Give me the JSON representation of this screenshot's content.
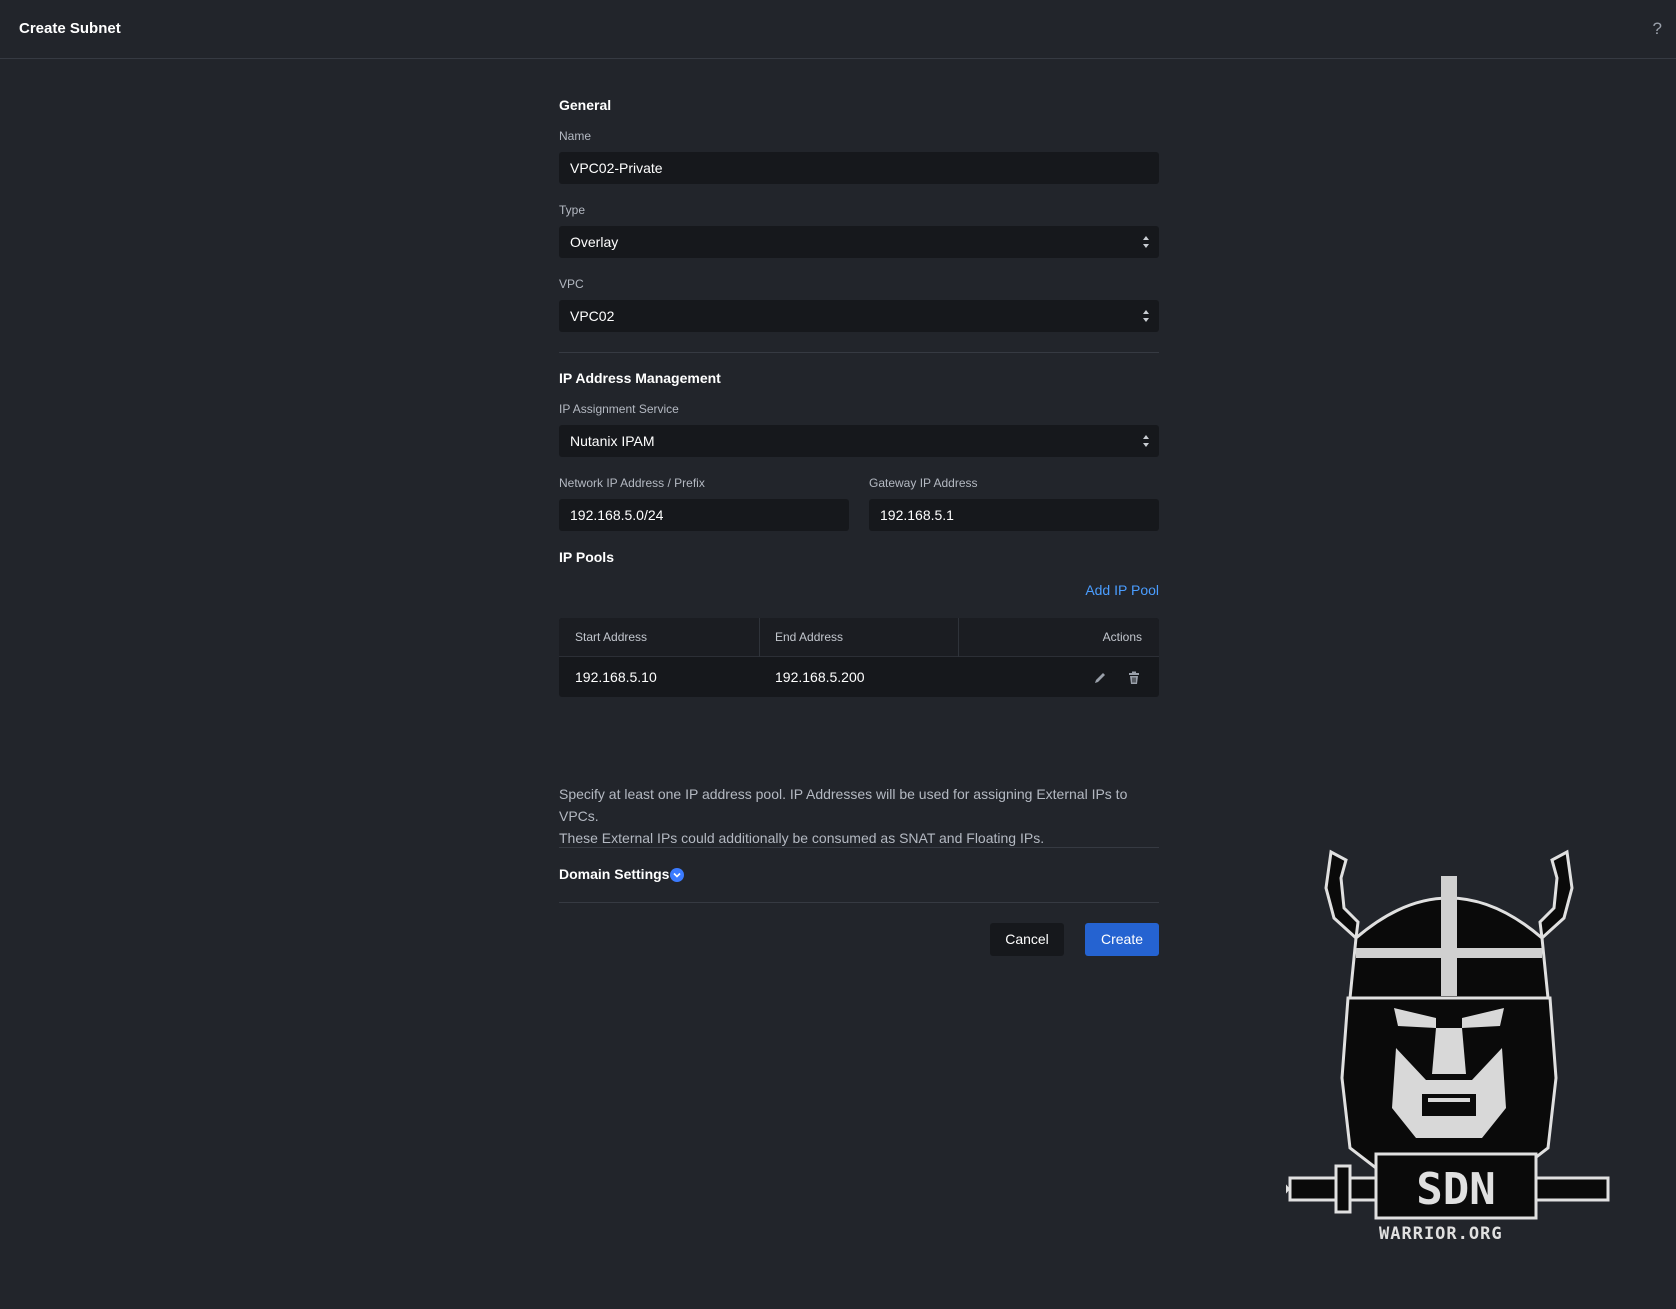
{
  "header": {
    "title": "Create Subnet",
    "help_label": "?"
  },
  "general": {
    "section_title": "General",
    "name_label": "Name",
    "name_value": "VPC02-Private",
    "type_label": "Type",
    "type_value": "Overlay",
    "vpc_label": "VPC",
    "vpc_value": "VPC02"
  },
  "ipam": {
    "section_title": "IP Address Management",
    "service_label": "IP Assignment Service",
    "service_value": "Nutanix IPAM",
    "network_label": "Network IP Address / Prefix",
    "network_value": "192.168.5.0/24",
    "gateway_label": "Gateway IP Address",
    "gateway_value": "192.168.5.1"
  },
  "pools": {
    "section_title": "IP Pools",
    "add_label": "Add IP Pool",
    "columns": [
      "Start Address",
      "End Address",
      "Actions"
    ],
    "rows": [
      {
        "start": "192.168.5.10",
        "end": "192.168.5.200"
      }
    ],
    "help_line1": "Specify at least one IP address pool. IP Addresses will be used for assigning External IPs to VPCs.",
    "help_line2": "These External IPs could additionally be consumed as SNAT and Floating IPs."
  },
  "domain": {
    "label": "Domain Settings"
  },
  "actions": {
    "cancel_label": "Cancel",
    "create_label": "Create"
  },
  "watermark": {
    "text": "WARRIOR.ORG",
    "letters": "SDN"
  },
  "colors": {
    "accent": "#2563d1",
    "link": "#4a9dff",
    "background": "#22252b",
    "field": "#16181c"
  }
}
